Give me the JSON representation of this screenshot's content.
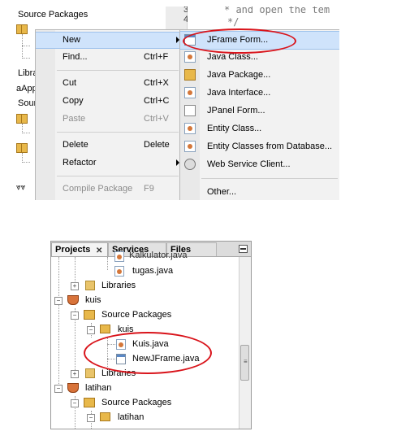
{
  "top": {
    "tree": {
      "source_packages": "Source Packages",
      "libraries_partial": "Libra",
      "app_partial": "aApp",
      "source_partial": "Sour"
    },
    "editor": {
      "line_number": "4",
      "line_number_prev": "3",
      "code_line": "* and open the tem",
      "code_line2": "*/"
    },
    "context_menu": {
      "items": [
        {
          "label": "New",
          "shortcut": "",
          "submenu": true
        },
        {
          "label": "Find...",
          "shortcut": "Ctrl+F"
        },
        {
          "label": "Cut",
          "shortcut": "Ctrl+X"
        },
        {
          "label": "Copy",
          "shortcut": "Ctrl+C"
        },
        {
          "label": "Paste",
          "shortcut": "Ctrl+V",
          "disabled": true
        },
        {
          "label": "Delete",
          "shortcut": "Delete"
        },
        {
          "label": "Refactor",
          "shortcut": "",
          "submenu": true
        },
        {
          "label": "Compile Package",
          "shortcut": "F9",
          "disabled": true
        }
      ]
    },
    "submenu": {
      "items": [
        {
          "label": "JFrame Form...",
          "icon": "jframe-form-icon"
        },
        {
          "label": "Java Class...",
          "icon": "java-class-icon"
        },
        {
          "label": "Java Package...",
          "icon": "java-package-icon"
        },
        {
          "label": "Java Interface...",
          "icon": "java-interface-icon"
        },
        {
          "label": "JPanel Form...",
          "icon": "jpanel-form-icon"
        },
        {
          "label": "Entity Class...",
          "icon": "entity-class-icon"
        },
        {
          "label": "Entity Classes from Database...",
          "icon": "entity-db-icon"
        },
        {
          "label": "Web Service Client...",
          "icon": "web-service-icon"
        },
        {
          "label": "Other...",
          "icon": ""
        }
      ]
    }
  },
  "bottom": {
    "tabs": {
      "projects": "Projects",
      "close": "✕",
      "services": "Services",
      "files": "Files"
    },
    "tree": {
      "partial_top": "Kalkulator.java",
      "tugas": "tugas.java",
      "libraries1": "Libraries",
      "kuis_project": "kuis",
      "source_packages1": "Source Packages",
      "kuis_package": "kuis",
      "kuis_java": "Kuis.java",
      "newjframe_java": "NewJFrame.java",
      "libraries2": "Libraries",
      "latihan_project": "latihan",
      "source_packages2": "Source Packages",
      "latihan_package": "latihan"
    },
    "colors": {
      "highlight": "#d9141b"
    }
  }
}
